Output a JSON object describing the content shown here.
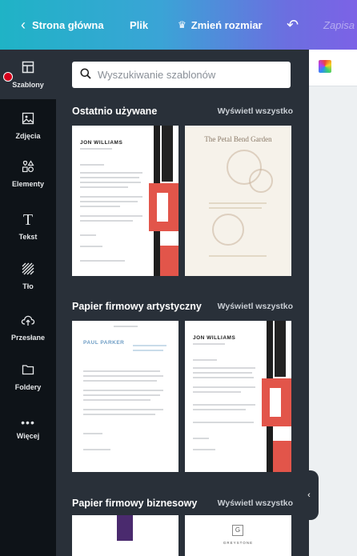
{
  "topbar": {
    "back_label": "Strona główna",
    "file_label": "Plik",
    "resize_label": "Zmień rozmiar",
    "save_label": "Zapisa"
  },
  "rail": {
    "items": [
      {
        "label": "Szablony",
        "icon": "layout-icon"
      },
      {
        "label": "Zdjęcia",
        "icon": "image-icon"
      },
      {
        "label": "Elementy",
        "icon": "shapes-icon"
      },
      {
        "label": "Tekst",
        "icon": "text-icon"
      },
      {
        "label": "Tło",
        "icon": "background-pattern-icon"
      },
      {
        "label": "Przesłane",
        "icon": "upload-cloud-icon"
      },
      {
        "label": "Foldery",
        "icon": "folder-icon"
      },
      {
        "label": "Więcej",
        "icon": "more-dots-icon"
      }
    ]
  },
  "search": {
    "placeholder": "Wyszukiwanie szablonów"
  },
  "sections": [
    {
      "title": "Ostatnio używane",
      "link": "Wyświetl wszystko"
    },
    {
      "title": "Papier firmowy artystyczny",
      "link": "Wyświetl wszystko"
    },
    {
      "title": "Papier firmowy biznesowy",
      "link": "Wyświetl wszystko"
    }
  ],
  "templates": {
    "jon_name": "JON WILLIAMS",
    "petal_title": "The Petal Bend Garden",
    "paul_name": "PAUL PARKER",
    "greystone_name": "GREYSTONE"
  },
  "colors": {
    "topbar_start": "#1fb3c6",
    "topbar_end": "#7c62e6",
    "rail_bg": "#0e1318",
    "panel_bg": "#293039",
    "accent_red": "#e2554a",
    "notification_dot": "#d5001c"
  }
}
